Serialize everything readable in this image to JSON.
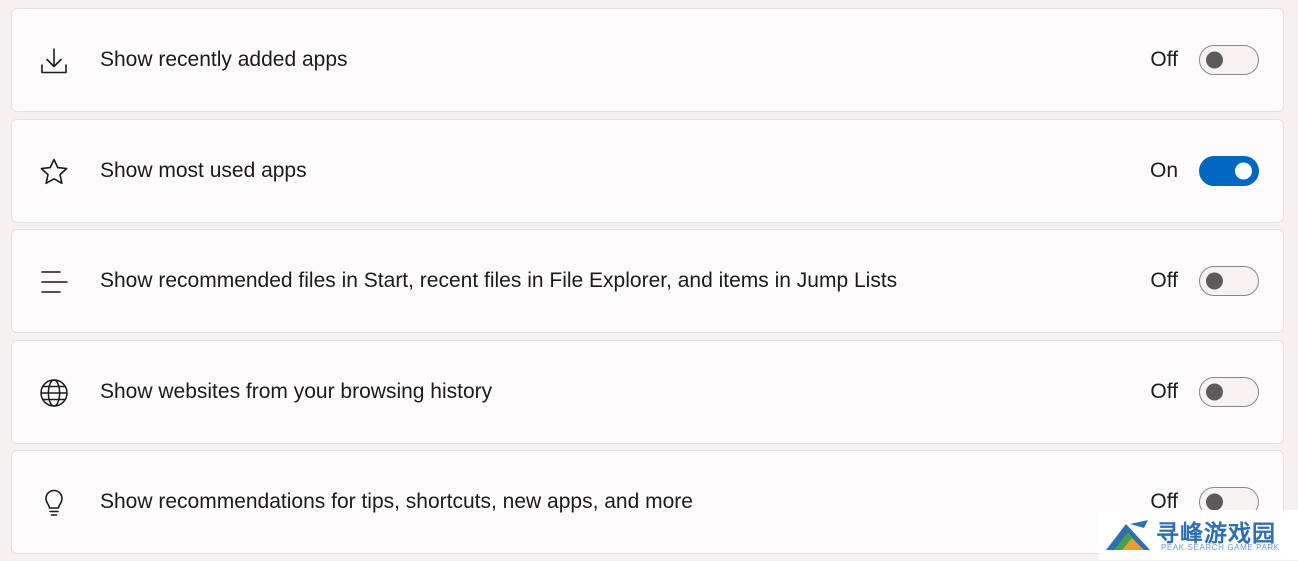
{
  "settings": [
    {
      "icon": "download-icon",
      "label": "Show recently added apps",
      "state_label": "Off",
      "enabled": false
    },
    {
      "icon": "star-icon",
      "label": "Show most used apps",
      "state_label": "On",
      "enabled": true
    },
    {
      "icon": "list-icon",
      "label": "Show recommended files in Start, recent files in File Explorer, and items in Jump Lists",
      "state_label": "Off",
      "enabled": false
    },
    {
      "icon": "globe-icon",
      "label": "Show websites from your browsing history",
      "state_label": "Off",
      "enabled": false
    },
    {
      "icon": "lightbulb-icon",
      "label": "Show recommendations for tips, shortcuts, new apps, and more",
      "state_label": "Off",
      "enabled": false
    }
  ],
  "watermark": {
    "title": "寻峰游戏园",
    "subtitle": "PEAK SEARCH GAME PARK"
  },
  "colors": {
    "accent": "#0067c0",
    "card_background": "#fdfbfb",
    "page_background": "#f6f0f1",
    "toggle_off_thumb": "#5c5a5a"
  }
}
